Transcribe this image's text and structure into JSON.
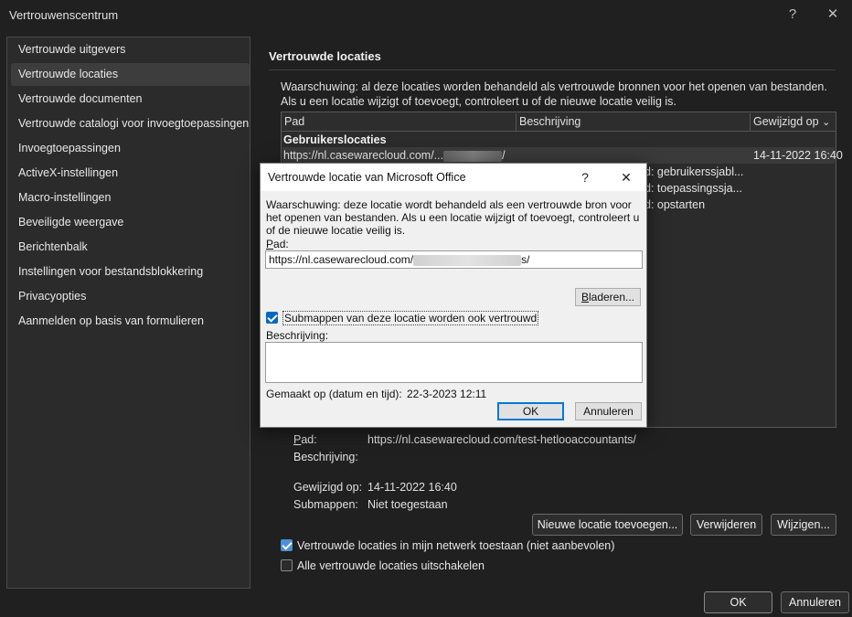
{
  "window": {
    "title": "Vertrouwenscentrum",
    "help_glyph": "?",
    "close_glyph": "✕"
  },
  "sidebar": {
    "items": [
      {
        "label": "Vertrouwde uitgevers"
      },
      {
        "label": "Vertrouwde locaties",
        "active": true
      },
      {
        "label": "Vertrouwde documenten"
      },
      {
        "label": "Vertrouwde catalogi voor invoegtoepassingen"
      },
      {
        "label": "Invoegtoepassingen"
      },
      {
        "label": "ActiveX-instellingen"
      },
      {
        "label": "Macro-instellingen"
      },
      {
        "label": "Beveiligde weergave"
      },
      {
        "label": "Berichtenbalk"
      },
      {
        "label": "Instellingen voor bestandsblokkering"
      },
      {
        "label": "Privacyopties"
      },
      {
        "label": "Aanmelden op basis van formulieren"
      }
    ]
  },
  "main": {
    "title": "Vertrouwde locaties",
    "warning": "Waarschuwing: al deze locaties worden behandeld als vertrouwde bronnen voor het openen van bestanden. Als u een locatie wijzigt of toevoegt, controleert u of de nieuwe locatie veilig is.",
    "table": {
      "columns": [
        "Pad",
        "Beschrijving",
        "Gewijzigd op"
      ],
      "sort_glyph": "⌄",
      "group": "Gebruikerslocaties",
      "rows": [
        {
          "path": "https://nl.casewarecloud.com/...",
          "path_end": "/",
          "desc": "",
          "modified": "14-11-2022 16:40"
        },
        {
          "desc_tail": "d: gebruikerssjabl..."
        },
        {
          "desc_tail": "d: toepassingssja..."
        },
        {
          "desc_tail": "d: opstarten"
        }
      ]
    },
    "details": {
      "path_label": "Pad:",
      "path_value": "https://nl.casewarecloud.com/test-hetlooaccountants/",
      "desc_label": "Beschrijving:",
      "desc_value": "",
      "modified_label": "Gewijzigd op:",
      "modified_value": "14-11-2022 16:40",
      "subfolders_label": "Submappen:",
      "subfolders_value": "Niet toegestaan"
    },
    "buttons": {
      "add": "Nieuwe locatie toevoegen...",
      "remove": "Verwijderen",
      "modify": "Wijzigen..."
    },
    "checkboxes": {
      "network": {
        "label": "Vertrouwde locaties in mijn netwerk toestaan (niet aanbevolen)",
        "checked": true
      },
      "disable_all": {
        "label": "Alle vertrouwde locaties uitschakelen",
        "checked": false
      }
    }
  },
  "footer": {
    "ok": "OK",
    "cancel": "Annuleren"
  },
  "dialog": {
    "title": "Vertrouwde locatie van Microsoft Office",
    "help_glyph": "?",
    "close_glyph": "✕",
    "warning": "Waarschuwing: deze locatie wordt behandeld als een vertrouwde bron voor het openen van bestanden. Als u een locatie wijzigt of toevoegt, controleert u of de nieuwe locatie veilig is.",
    "path_label": "Pad:",
    "path_value": "https://nl.casewarecloud.com/",
    "path_end": "s/",
    "browse": "Bladeren...",
    "subfolders": {
      "label": "Submappen van deze locatie worden ook vertrouwd",
      "checked": true
    },
    "desc_label": "Beschrijving:",
    "desc_value": "",
    "created_label": "Gemaakt op (datum en tijd):",
    "created_value": "22-3-2023 12:11",
    "ok": "OK",
    "cancel": "Annuleren"
  }
}
